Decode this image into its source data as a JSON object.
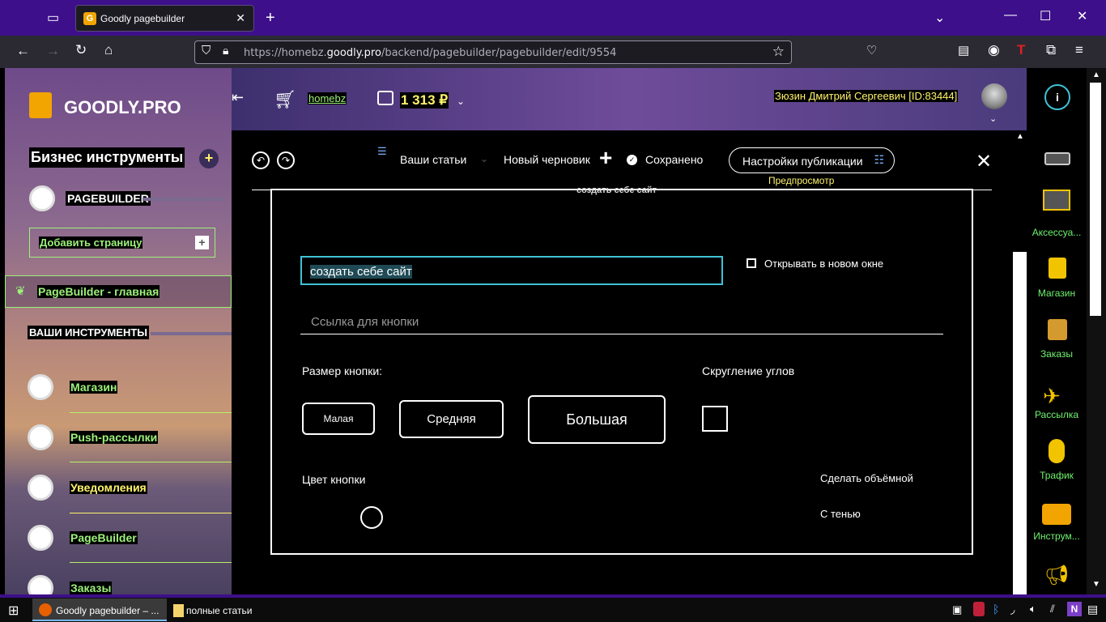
{
  "browser": {
    "tab_title": "Goodly pagebuilder",
    "favicon_letter": "G",
    "url_prefix": "https://homebz.",
    "url_domain": "goodly.pro",
    "url_path": "/backend/pagebuilder/pagebuilder/edit/9554"
  },
  "sidebar": {
    "logo_text": "GOODLY.PRO",
    "business_tools": "Бизнес инструменты",
    "plus": "+",
    "pagebuilder_title": "PAGEBUILDER",
    "add_page": "Добавить страницу",
    "pagebuilder_main": "PageBuilder - главная",
    "your_tools": "ВАШИ ИНСТРУМЕНТЫ",
    "items": [
      {
        "label": "Магазин"
      },
      {
        "label": "Push-рассылки"
      },
      {
        "label": "Уведомления"
      },
      {
        "label": "PageBuilder"
      },
      {
        "label": "Заказы"
      }
    ]
  },
  "header": {
    "site": "homebz",
    "balance": "1 313 ₽",
    "user": "Зюзин Дмитрий Сергеевич [ID:83444]"
  },
  "toolbar": {
    "your_articles": "Ваши статьи",
    "new_draft": "Новый черновик",
    "saved": "Сохранено",
    "publish_settings": "Настройки публикации",
    "preview": "Предпросмотр"
  },
  "panel": {
    "header_cut": "создать себе сайт",
    "button_text_value": "создать себе сайт",
    "open_new_window": "Открывать в новом окне",
    "link_placeholder": "Ссылка для кнопки",
    "size_label": "Размер кнопки:",
    "size_small": "Малая",
    "size_medium": "Средняя",
    "size_large": "Большая",
    "rounding_label": "Скругление углов",
    "color_label": "Цвет кнопки",
    "make_3d": "Сделать объёмной",
    "with_shadow": "С тенью"
  },
  "rightbar": {
    "items": [
      {
        "label": "Аксессуа..."
      },
      {
        "label": "Магазин"
      },
      {
        "label": "Заказы"
      },
      {
        "label": "Рассылка"
      },
      {
        "label": "Трафик"
      },
      {
        "label": "Инструм..."
      }
    ]
  },
  "taskbar": {
    "app1": "Goodly pagebuilder – ...",
    "app2": "полные статьи"
  },
  "colors": {
    "titlebar": "#3d0f8a",
    "accent_green": "#9cf27a",
    "accent_yellow": "#fff36a",
    "input_border": "#3fc2d6"
  }
}
